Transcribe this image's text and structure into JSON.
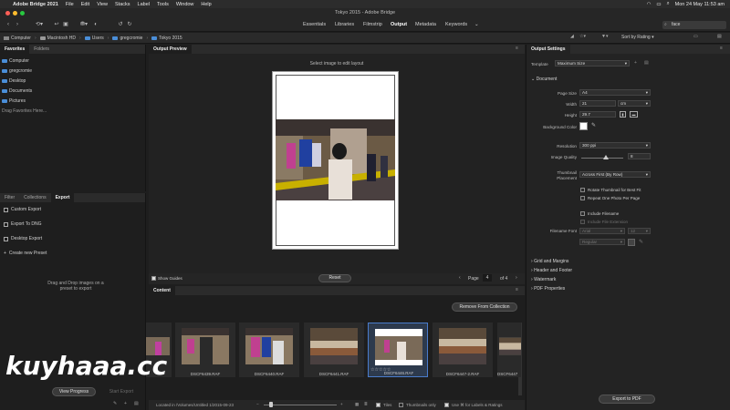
{
  "menubar": {
    "app_name": "Adobe Bridge 2021",
    "items": [
      "File",
      "Edit",
      "View",
      "Stacks",
      "Label",
      "Tools",
      "Window",
      "Help"
    ],
    "clock": "Mon 24 May  11:53 am"
  },
  "window": {
    "title": "Tokyo 2015 - Adobe Bridge"
  },
  "toolbar": {
    "workspaces": [
      "Essentials",
      "Libraries",
      "Filmstrip",
      "Output",
      "Metadata",
      "Keywords"
    ],
    "active_workspace": "Output",
    "search_value": "face",
    "sort_label": "Sort by Rating"
  },
  "path": {
    "crumbs": [
      "Computer",
      "Macintosh HD",
      "Users",
      "gregcromie",
      "Tokyo 2015"
    ]
  },
  "left_top": {
    "tabs": [
      "Favorites",
      "Folders"
    ],
    "items": [
      "Computer",
      "gregcromie",
      "Desktop",
      "Documents",
      "Pictures"
    ],
    "drag_hint": "Drag Favorites Here..."
  },
  "left_bottom": {
    "tabs": [
      "Filter",
      "Collections",
      "Export"
    ],
    "items": [
      "Custom Export",
      "Export To DNG",
      "Desktop Export"
    ],
    "create_preset": "Create new Preset",
    "drop_hint": "Drag and Drop images on a preset to export",
    "view_progress": "View Progress",
    "start_export": "Start Export"
  },
  "preview": {
    "tab": "Output Preview",
    "hint": "Select image to edit layout",
    "show_guides": "Show Guides",
    "reset": "Reset",
    "page_label": "Page",
    "page_num": "4",
    "page_of": "of 4"
  },
  "content": {
    "tab": "Content",
    "remove_button": "Remove From Collection",
    "thumbs": [
      "DSCF6439.RAF",
      "DSCF6440.RAF",
      "DSCF6441.RAF",
      "DSCF6446.RAF",
      "DSCF6447-2.RAF",
      "DSCF6447"
    ],
    "selected_index": 3,
    "stars": "☆☆☆☆☆"
  },
  "status": {
    "location": "Located in /Volumes/Untitled 1/2015-09-23",
    "tiles": "Tiles",
    "thumbs_only": "Thumbnails only",
    "use_labels": "Use ⌘ for Labels & Ratings"
  },
  "output": {
    "tab": "Output Settings",
    "template_label": "Template",
    "template_value": "Maximum Size",
    "document": "Document",
    "page_size_label": "Page Size",
    "page_size": "A4",
    "width_label": "Width",
    "width": "21",
    "unit": "cm",
    "height_label": "Height",
    "height": "29.7",
    "bg_label": "Background Color",
    "resolution_label": "Resolution",
    "resolution": "300 ppi",
    "quality_label": "Image Quality",
    "quality": "8",
    "quality_level": 0.58,
    "thumb_label": "Thumbnail Placement",
    "thumb_value": "Across First (By Row)",
    "rotate": "Rotate Thumbnail for Best Fit",
    "repeat": "Repeat One Photo Per Page",
    "include_filename": "Include Filename",
    "include_ext": "Include File Extension",
    "font_label": "Filename Font",
    "font_value": "Arial",
    "font_size": "12",
    "font_style": "Regular",
    "sections": [
      "Grid and Margins",
      "Header and Footer",
      "Watermark",
      "PDF Properties"
    ],
    "export_pdf": "Export to PDF"
  },
  "watermark_text": "kuyhaaa.cc",
  "colors": {
    "accent": "#4a7ccc",
    "folder": "#4a8ed8"
  }
}
